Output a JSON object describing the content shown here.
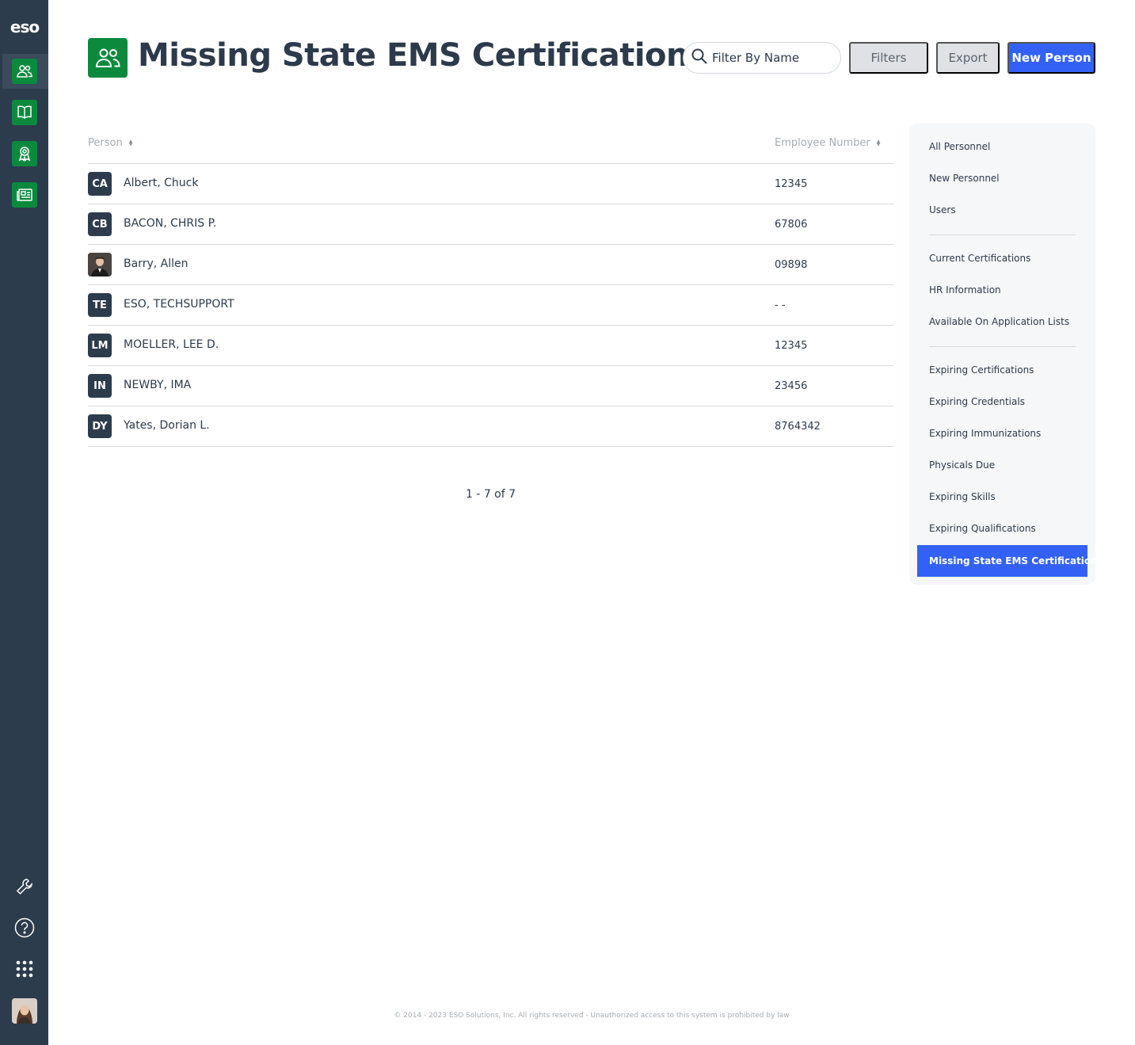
{
  "brand": {
    "logo_text": "eso",
    "accent": "#0b8a3e",
    "primary": "#3461f5",
    "rail_bg": "#2d3c4c"
  },
  "rail": {
    "items": [
      {
        "icon": "people-icon",
        "active": true
      },
      {
        "icon": "book-icon",
        "active": false
      },
      {
        "icon": "award-icon",
        "active": false
      },
      {
        "icon": "news-icon",
        "active": false
      }
    ],
    "bottom": [
      {
        "icon": "wrench-icon"
      },
      {
        "icon": "help-icon"
      },
      {
        "icon": "apps-grid-icon"
      },
      {
        "icon": "user-avatar"
      }
    ]
  },
  "header": {
    "title": "Missing State EMS Certifications",
    "search_placeholder": "Filter By Name",
    "filters_label": "Filters",
    "export_label": "Export",
    "new_person_label": "New Person"
  },
  "table": {
    "columns": [
      "Person",
      "Employee Number"
    ],
    "rows": [
      {
        "initials": "CA",
        "name": "Albert, Chuck",
        "employee_number": "12345",
        "photo": false
      },
      {
        "initials": "CB",
        "name": "BACON, CHRIS P.",
        "employee_number": "67806",
        "photo": false
      },
      {
        "initials": "",
        "name": "Barry, Allen",
        "employee_number": "09898",
        "photo": true
      },
      {
        "initials": "TE",
        "name": "ESO, TECHSUPPORT",
        "employee_number": "- -",
        "photo": false
      },
      {
        "initials": "LM",
        "name": "MOELLER, LEE D.",
        "employee_number": "12345",
        "photo": false
      },
      {
        "initials": "IN",
        "name": "NEWBY, IMA",
        "employee_number": "23456",
        "photo": false
      },
      {
        "initials": "DY",
        "name": "Yates, Dorian L.",
        "employee_number": "8764342",
        "photo": false
      }
    ],
    "pagination": "1 - 7 of 7"
  },
  "side_menu": {
    "group1": [
      "All Personnel",
      "New Personnel",
      "Users"
    ],
    "group2": [
      "Current Certifications",
      "HR Information",
      "Available On Application Lists"
    ],
    "group3": [
      "Expiring Certifications",
      "Expiring Credentials",
      "Expiring Immunizations",
      "Physicals Due",
      "Expiring Skills",
      "Expiring Qualifications"
    ],
    "active": "Missing State EMS Certifications"
  },
  "footer": "© 2014 - 2023 ESO Solutions, Inc. All rights reserved - Unauthorized access to this system is prohibited by law"
}
